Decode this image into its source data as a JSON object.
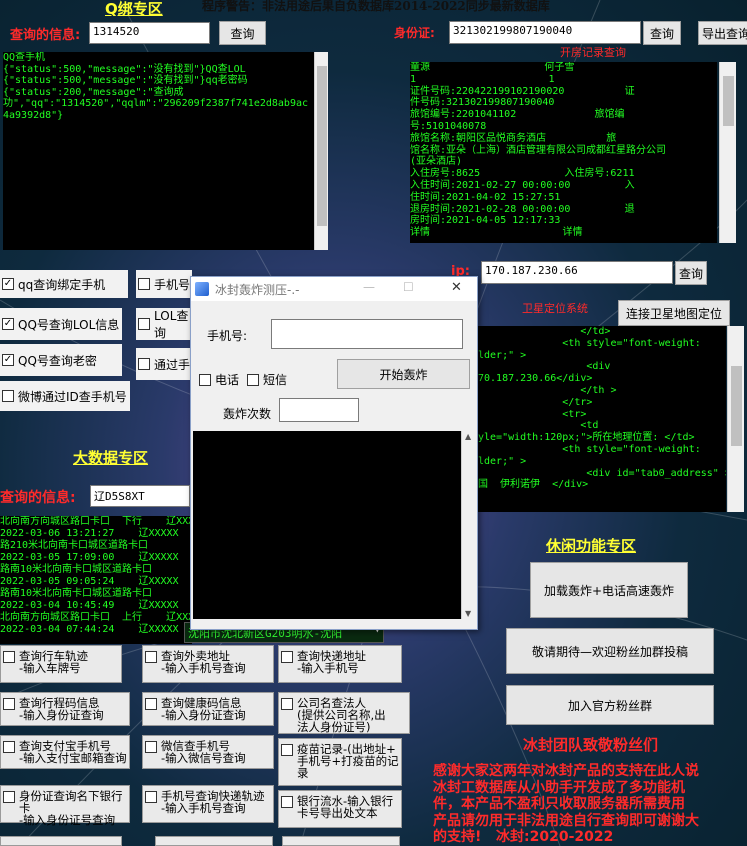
{
  "banner": "程序警告：非法用途后果自负数据库2014-2022同步最新数据库",
  "qq_section": {
    "title": "Q绑专区",
    "query_label": "查询的信息:",
    "query_value": "1314520",
    "query_btn": "查询",
    "output": "QQ查手机\n{\"status\":500,\"message\":\"没有找到\"}QQ查LOL\n{\"status\":500,\"message\":\"没有找到\"}qq老密码\n{\"status\":200,\"message\":\"查询成\n功\",\"qq\":\"1314520\",\"qqlm\":\"296209f2387f741e2d8ab9ac\n4a9392d8\"}"
  },
  "hotel": {
    "label": "身份证:",
    "value": "321302199807190040",
    "query_btn": "查询",
    "export_btn": "导出查询",
    "subtitle": "开房记录查询",
    "output": "童源                   何子雪\n1                      1\n证件号码:220422199102190020          证\n件号码:321302199807190040\n旅馆编号:2201041102             旅馆编\n号:5101040078\n旅馆名称:朝阳区品悦商务酒店          旅\n馆名称:亚朵（上海）酒店管理有限公司成都红星路分公司\n(亚朵酒店)\n入住房号:8625              入住房号:6211\n入住时间:2021-02-27 00:00:00         入\n住时间:2021-04-02 15:27:51\n退房时间:2021-02-28 00:00:00         退\n房时间:2021-04-05 12:17:33\n详情                      详情"
  },
  "options": [
    {
      "label": "qq查询绑定手机",
      "checked": true
    },
    {
      "label": "手机号",
      "checked": false
    },
    {
      "label": "QQ号查询LOL信息",
      "checked": true
    },
    {
      "label": "LOL查询",
      "checked": false
    },
    {
      "label": "QQ号查询老密",
      "checked": true
    },
    {
      "label": "通过手",
      "checked": false
    },
    {
      "label": "微博通过ID查手机号",
      "checked": false
    }
  ],
  "ip": {
    "label": "ip:",
    "value": "170.187.230.66",
    "query_btn": "查询",
    "subtitle": "卫星定位系统",
    "map_btn": "连接卫星地图定位",
    "output": "                 </td>\n              <th style=\"font-weight:\nlder;\" >\n                  <div\n70.187.230.66</div>\n                 </th >\n              </tr>\n              <tr>\n                 <td\nyle=\"width:120px;\">所在地理位置: </td>\n              <th style=\"font-weight:\nlder;\" >\n                  <div id=\"tab0_address\" >\n国  伊利诺伊  </div>"
  },
  "dialog": {
    "title": "冰封轰炸测压-.-",
    "phone_label": "手机号:",
    "phone_value": "",
    "call_label": "电话",
    "sms_label": "短信",
    "start_btn": "开始轰炸",
    "count_label": "轰炸次数",
    "count_value": "",
    "min": "—",
    "max": "☐",
    "close": "✕"
  },
  "bigdata": {
    "title": "大数据专区",
    "query_label": "查询的信息:",
    "query_value": "辽D5S8XT",
    "output": "北向南方向城区路口卡口  下行    辽XXXXX\n2022-03-06 13:21:27    辽XXXXX\n路210米北向南卡口城区道路卡口\n2022-03-05 17:09:00    辽XXXXX\n路南10米北向南卡口城区道路卡口\n2022-03-05 09:05:24    辽XXXXX\n路南10米北向南卡口城区道路卡口\n2022-03-04 10:45:49    辽XXXXX\n北向南方向城区路口卡口  上行    辽XXXXX\n2022-03-04 07:44:24    辽XXXXX",
    "combo": "沈阳市沈北新区G203明水-沈阳"
  },
  "leisure": {
    "title": "休闲功能专区",
    "btn1": "加载轰炸+电话高速轰炸",
    "btn2": "敬请期待—欢迎粉丝加群投稿",
    "btn3": "加入官方粉丝群",
    "thanks_title": "冰封团队致敬粉丝们",
    "thanks_text": "感谢大家这两年对冰封产品的支持在此人说\n冰封工数据库从小助手开发成了多功能机\n件，本产品不盈利只收取服务器所需费用\n产品请勿用于非法用途自行查询即可谢谢大\n的支持!   冰封:2020-2022"
  },
  "queries": [
    {
      "l1": "查询行车轨迹",
      "l2": "-输入车牌号"
    },
    {
      "l1": "查询外卖地址",
      "l2": "-输入手机号查询"
    },
    {
      "l1": "查询快递地址",
      "l2": "-输入手机号"
    },
    {
      "l1": "查询行程码信息",
      "l2": "-输入身份证查询"
    },
    {
      "l1": "查询健康码信息",
      "l2": "-输入身份证查询"
    },
    {
      "l1": "公司名查法人",
      "l2": "(提供公司名称,出",
      "l3": "法人身份证号)"
    },
    {
      "l1": "查询支付宝手机号",
      "l2": "-输入支付宝邮箱查询"
    },
    {
      "l1": "微信查手机号",
      "l2": "-输入微信号查询"
    },
    {
      "l1": "疫苗记录-(出地址+",
      "l2": "手机号+打疫苗的记",
      "l3": "录"
    },
    {
      "l1": "身份证查询名下银行卡",
      "l2": "-输入身份证号查询"
    },
    {
      "l1": "手机号查询快递轨迹",
      "l2": "-输入手机号查询"
    },
    {
      "l1": "银行流水-输入银行",
      "l2": "卡号导出处文本"
    }
  ]
}
